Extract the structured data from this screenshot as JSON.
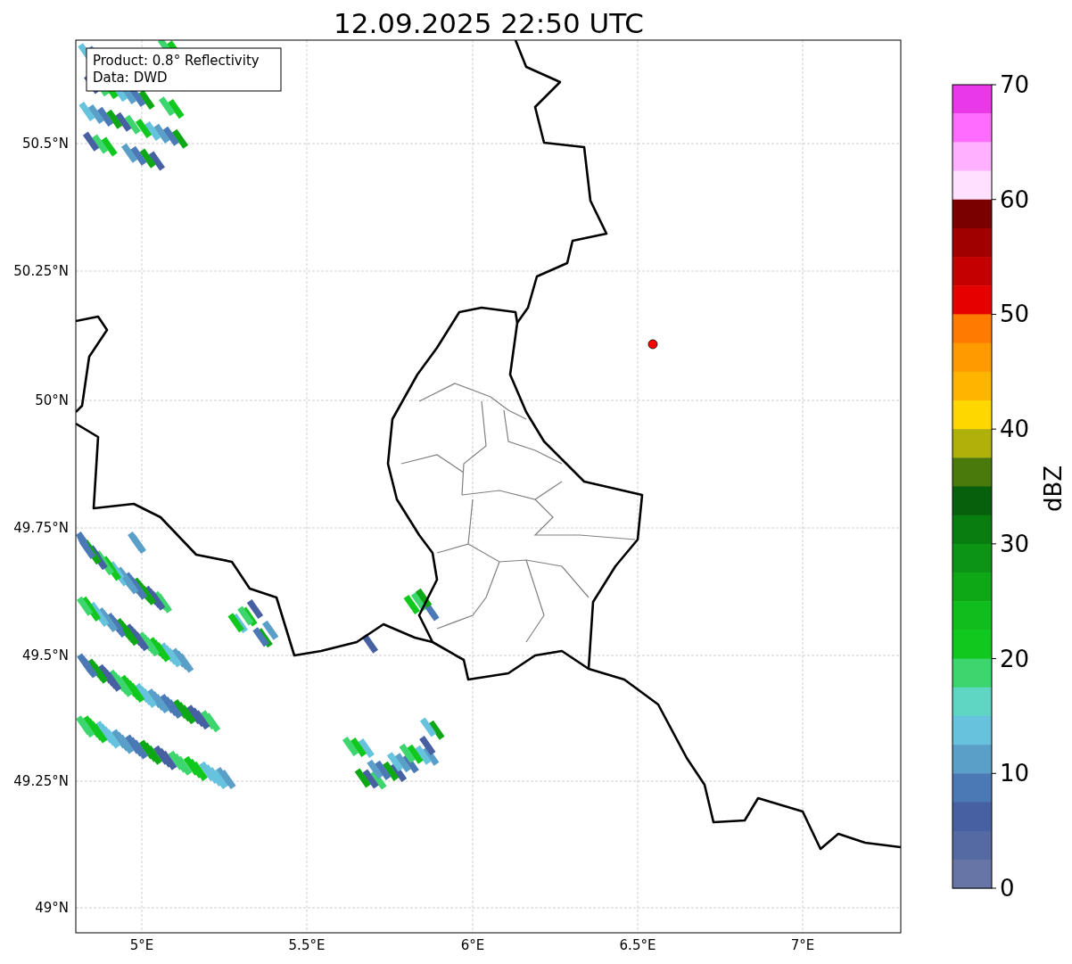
{
  "title": "12.09.2025 22:50 UTC",
  "info_box": [
    "Product: 0.8° Reflectivity",
    "Data: DWD"
  ],
  "x_ticks": [
    "5°E",
    "5.5°E",
    "6°E",
    "6.5°E",
    "7°E"
  ],
  "y_ticks": [
    "50.5°N",
    "50.25°N",
    "50°N",
    "49.75°N",
    "49.5°N",
    "49.25°N",
    "49°N"
  ],
  "colorbar": {
    "label": "dBZ",
    "ticks": [
      "70",
      "60",
      "50",
      "40",
      "30",
      "20",
      "10",
      "0"
    ],
    "bins": [
      {
        "color": "#e838e8"
      },
      {
        "color": "#ff6cff"
      },
      {
        "color": "#ffb0ff"
      },
      {
        "color": "#ffe0ff"
      },
      {
        "color": "#7a0000"
      },
      {
        "color": "#a00000"
      },
      {
        "color": "#c40000"
      },
      {
        "color": "#e60000"
      },
      {
        "color": "#ff7b00"
      },
      {
        "color": "#ff9a00"
      },
      {
        "color": "#ffb400"
      },
      {
        "color": "#ffd700"
      },
      {
        "color": "#b0b00a"
      },
      {
        "color": "#4a7a0c"
      },
      {
        "color": "#07600c"
      },
      {
        "color": "#0a7d10"
      },
      {
        "color": "#0c9414"
      },
      {
        "color": "#0ea817"
      },
      {
        "color": "#10bd1c"
      },
      {
        "color": "#10c81e"
      },
      {
        "color": "#3dd66e"
      },
      {
        "color": "#5fd6c4"
      },
      {
        "color": "#66c2dd"
      },
      {
        "color": "#5a9fc8"
      },
      {
        "color": "#4a79b5"
      },
      {
        "color": "#4660a2"
      },
      {
        "color": "#5569a3"
      },
      {
        "color": "#6674a6"
      }
    ]
  }
}
